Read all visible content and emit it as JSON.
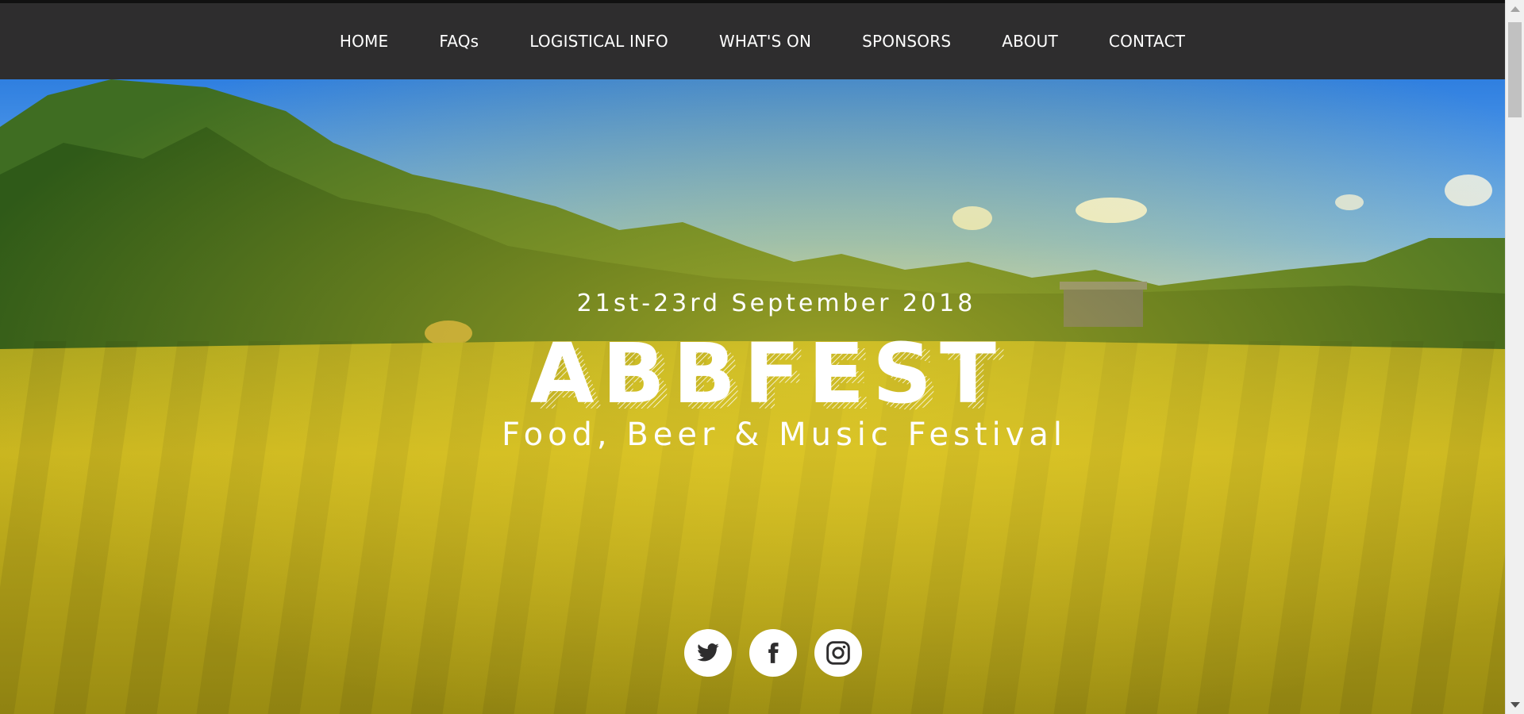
{
  "nav": {
    "items": [
      {
        "label": "HOME"
      },
      {
        "label": "FAQs"
      },
      {
        "label": "LOGISTICAL INFO"
      },
      {
        "label": "WHAT'S ON"
      },
      {
        "label": "SPONSORS"
      },
      {
        "label": "ABOUT"
      },
      {
        "label": "CONTACT"
      }
    ]
  },
  "hero": {
    "date": "21st-23rd September 2018",
    "title": "ABBFEST",
    "tagline": "Food, Beer & Music Festival"
  },
  "social": {
    "icons": [
      "twitter-icon",
      "facebook-icon",
      "instagram-icon"
    ]
  },
  "colors": {
    "navbar": "#2e2d2e",
    "nav_text": "#ffffff",
    "sky": "#3d8ee6",
    "grass": "#c9b420",
    "trees": "#3e6e1f"
  }
}
